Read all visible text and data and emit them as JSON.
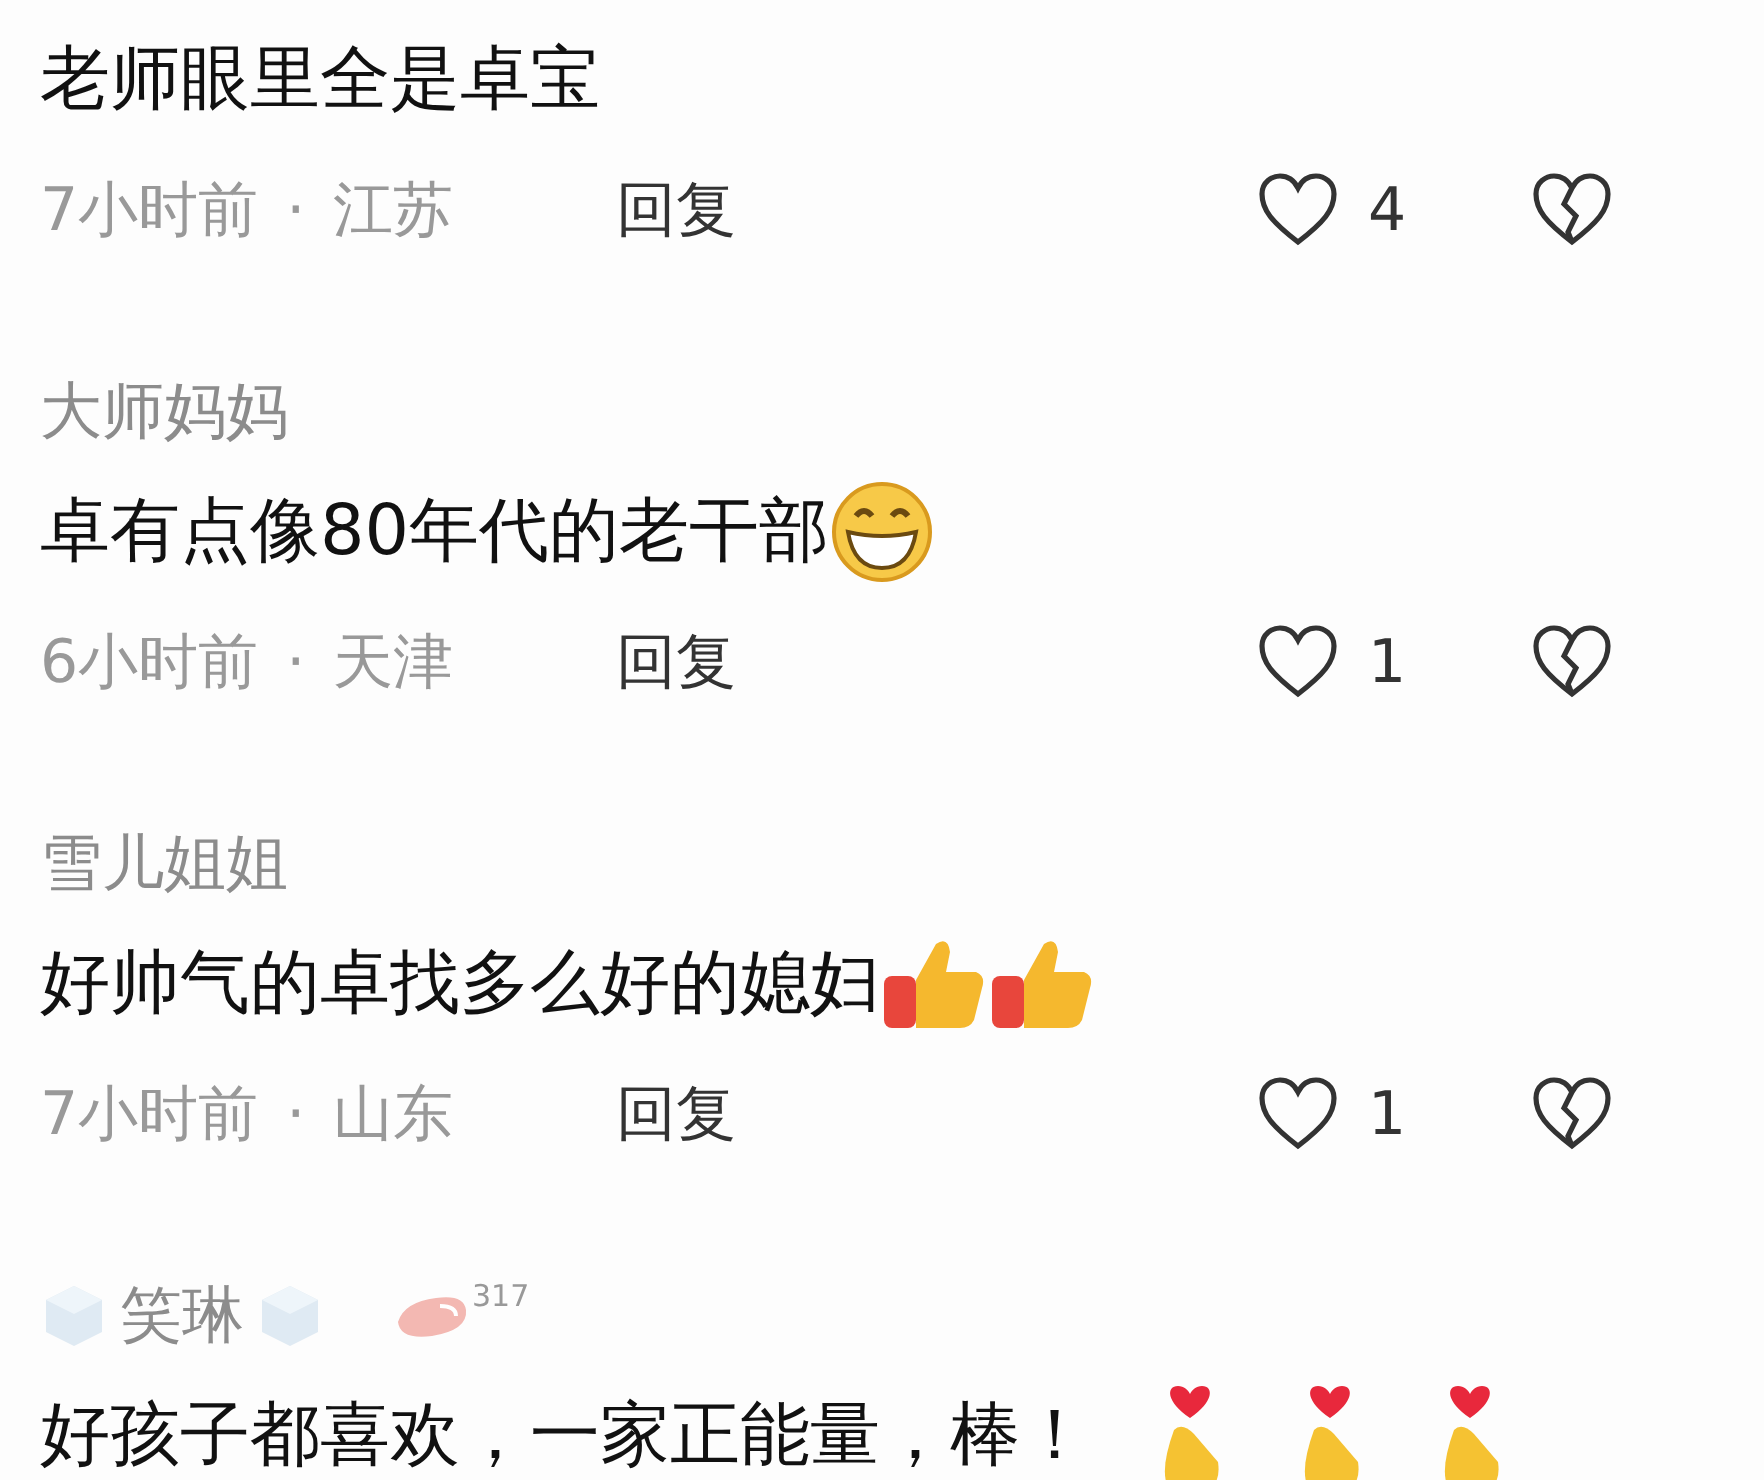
{
  "comments": [
    {
      "text": "老师眼里全是卓宝",
      "time": "7小时前",
      "separator": "·",
      "location": "江苏",
      "reply": "回复",
      "likes": "4"
    },
    {
      "author": "大师妈妈",
      "text": "卓有点像80年代的老干部",
      "emojis": [
        {
          "kind": "grin"
        }
      ],
      "time": "6小时前",
      "separator": "·",
      "location": "天津",
      "reply": "回复",
      "likes": "1"
    },
    {
      "author": "雪儿姐姐",
      "text": "好帅气的卓找多么好的媳妇",
      "emojis": [
        {
          "kind": "thumbs"
        },
        {
          "kind": "thumbs"
        }
      ],
      "time": "7小时前",
      "separator": "·",
      "location": "山东",
      "reply": "回复",
      "likes": "1"
    },
    {
      "author": "笑琳",
      "decorated": true,
      "badge": "317",
      "text": "好孩子都喜欢，一家正能量，棒！",
      "emojis": [
        {
          "kind": "heart-hand"
        },
        {
          "kind": "heart-hand"
        },
        {
          "kind": "heart-hand"
        }
      ]
    }
  ]
}
